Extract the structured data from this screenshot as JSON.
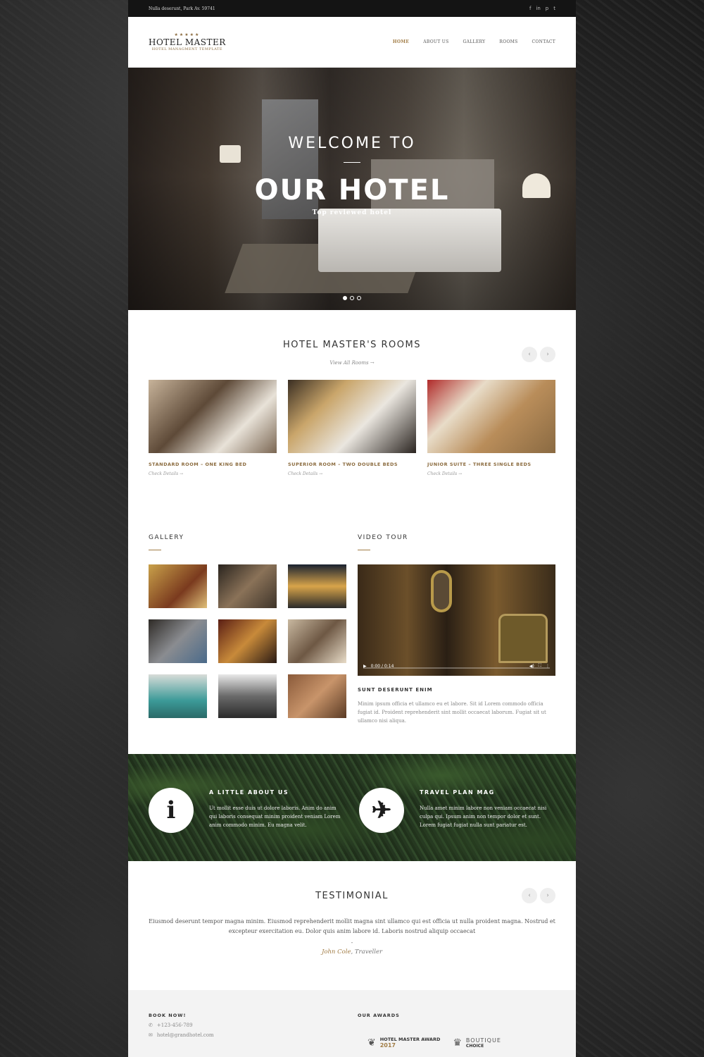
{
  "topbar": {
    "address": "Nulla deserunt, Park Av. 59741",
    "social": [
      "f",
      "in",
      "p",
      "t"
    ]
  },
  "logo": {
    "stars": "★★★★★",
    "name": "HOTEL MASTER",
    "subtitle": "HOTEL MANAGMENT TEMPLATE"
  },
  "nav": {
    "items": [
      {
        "label": "HOME",
        "active": true
      },
      {
        "label": "ABOUT US"
      },
      {
        "label": "GALLERY"
      },
      {
        "label": "ROOMS"
      },
      {
        "label": "CONTACT"
      }
    ]
  },
  "hero": {
    "welcome": "WELCOME TO",
    "title": "OUR HOTEL",
    "tagline": "Top reviewed hotel",
    "slides": 3,
    "active_slide": 1
  },
  "rooms": {
    "title": "HOTEL MASTER'S ROOMS",
    "view_all": "View All Rooms  →",
    "prev": "‹",
    "next": "›",
    "items": [
      {
        "title": "STANDARD ROOM – ONE KING BED",
        "link": "Check Details  →",
        "color": "#8c7a66"
      },
      {
        "title": "SUPERIOR ROOM – TWO DOUBLE BEDS",
        "link": "Check Details  →",
        "color": "#5b4e3e"
      },
      {
        "title": "JUNIOR SUITE – THREE SINGLE BEDS",
        "link": "Check Details  →",
        "color": "#a68563"
      }
    ]
  },
  "gallery": {
    "title": "GALLERY",
    "thumb_colors": [
      "#7a5a2e",
      "#4e4236",
      "#2a3a4a",
      "#4c4a45",
      "#5a2e1e",
      "#6e5844",
      "#3c7a78",
      "#3e3e3e",
      "#7a5238"
    ]
  },
  "video": {
    "title": "VIDEO TOUR",
    "time": "0:00 / 0:14",
    "heading": "SUNT DESERUNT ENIM",
    "desc": "Minim ipsum officia et ullamco eu et labore. Sit id Lorem commodo officia fugiat id. Proident reprehenderit sint mollit occaecat laborum. Fugiat sit ut ullamco nisi aliqua."
  },
  "band": {
    "about": {
      "title": "A LITTLE ABOUT US",
      "text": "Ut mollit esse duis ut dolore laboris. Anim do anim qui laboris consequat minim proident veniam Lorem anim commodo minim. Eu magna velit.",
      "icon": "i"
    },
    "travel": {
      "title": "TRAVEL PLAN MAG",
      "text": "Nulla amet minim labore non veniam occaecat nisi culpa qui. Ipsum anim non tempor dolor et sunt. Lorem fugiat fugiat nulla sunt pariatur est.",
      "icon": "✈"
    }
  },
  "testimonial": {
    "title": "TESTIMONIAL",
    "quote": "Eiusmod deserunt tempor magna minim. Eiusmod reprehenderit mollit magna sint ullamco qui est officia ut nulla proident magna. Nostrud et excepteur exercitation eu. Dolor quis anim labore id. Laboris nostrud aliquip occaecat",
    "dash": "-",
    "author": "John Cole",
    "role": ", Traveller",
    "prev": "‹",
    "next": "›"
  },
  "footer": {
    "book_title": "BOOK NOW!",
    "phone": "+123-456-789",
    "email": "hotel@grandhotel.com",
    "awards_title": "OUR AWARDS",
    "award1_line1": "HOTEL MASTER AWARD",
    "award1_line2": "2017",
    "award2_line1": "BOUTIQUE",
    "award2_line2": "CHOICE"
  }
}
